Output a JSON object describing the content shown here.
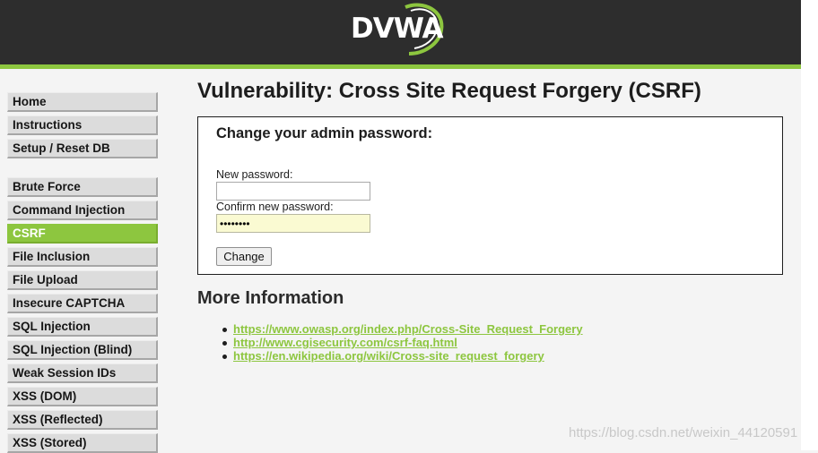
{
  "header": {
    "logo_text": "DVWA",
    "colors": {
      "header_bg": "#2d2d2d",
      "accent": "#8dc63f"
    }
  },
  "sidebar": {
    "items": [
      {
        "label": "Home",
        "active": false
      },
      {
        "label": "Instructions",
        "active": false
      },
      {
        "label": "Setup / Reset DB",
        "active": false
      },
      {
        "label": "Brute Force",
        "active": false
      },
      {
        "label": "Command Injection",
        "active": false
      },
      {
        "label": "CSRF",
        "active": true
      },
      {
        "label": "File Inclusion",
        "active": false
      },
      {
        "label": "File Upload",
        "active": false
      },
      {
        "label": "Insecure CAPTCHA",
        "active": false
      },
      {
        "label": "SQL Injection",
        "active": false
      },
      {
        "label": "SQL Injection (Blind)",
        "active": false
      },
      {
        "label": "Weak Session IDs",
        "active": false
      },
      {
        "label": "XSS (DOM)",
        "active": false
      },
      {
        "label": "XSS (Reflected)",
        "active": false
      },
      {
        "label": "XSS (Stored)",
        "active": false
      }
    ]
  },
  "main": {
    "title": "Vulnerability: Cross Site Request Forgery (CSRF)",
    "form": {
      "heading": "Change your admin password:",
      "new_password_label": "New password:",
      "new_password_value": "",
      "confirm_password_label": "Confirm new password:",
      "confirm_password_value": "••••••••",
      "submit_label": "Change"
    },
    "more_info": {
      "title": "More Information",
      "links": [
        "https://www.owasp.org/index.php/Cross-Site_Request_Forgery",
        "http://www.cgisecurity.com/csrf-faq.html",
        "https://en.wikipedia.org/wiki/Cross-site_request_forgery"
      ]
    }
  },
  "watermark": "https://blog.csdn.net/weixin_44120591"
}
